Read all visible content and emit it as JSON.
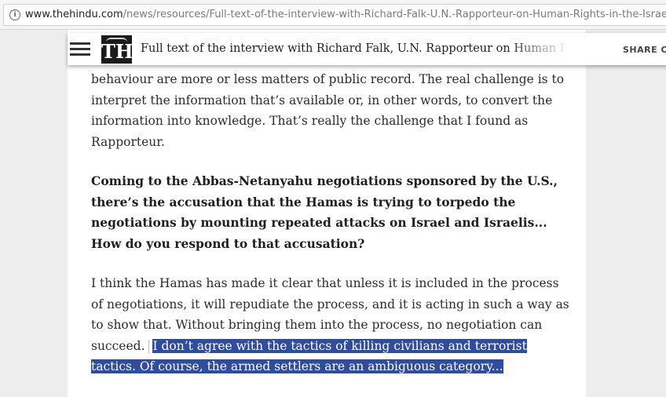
{
  "browser": {
    "url_host": "www.thehindu.com",
    "url_path": "/news/resources/Full-text-of-the-interview-with-Richard-Falk-U.N.-Rapporteur-on-Human-Rights-in-the-Israeli-O"
  },
  "header": {
    "logo_text": "TH",
    "title": "Full text of the interview with Richard Falk, U.N. Rapporteur on Human Rights in",
    "share_label": "SHARE ON"
  },
  "article": {
    "paragraph_1": "behaviour are more or less matters of public record. The real challenge is to interpret the information that’s available or, in other words, to convert the information into knowledge. That’s really the challenge that I found as Rapporteur.",
    "question": "Coming to the Abbas-Netanyahu negotiations sponsored by the U.S., there’s the accusation that the Hamas is trying to torpedo the negotiations by mounting repeated attacks on Israel and Israelis... How do you respond to that accusation?",
    "answer_plain": "I think the Hamas has made it clear that unless it is included in the process of negotiations, it will repudiate the process, and it is acting in such a way as to show that. Without bringing them into the process, no negotiation can succeed.",
    "answer_selected": "I don’t agree with the tactics of killing civilians and terrorist tactics. Of course, the armed settlers are an ambiguous category..."
  },
  "colors": {
    "selection": "#2e4da0",
    "logo_bg": "#1b1b1b"
  }
}
